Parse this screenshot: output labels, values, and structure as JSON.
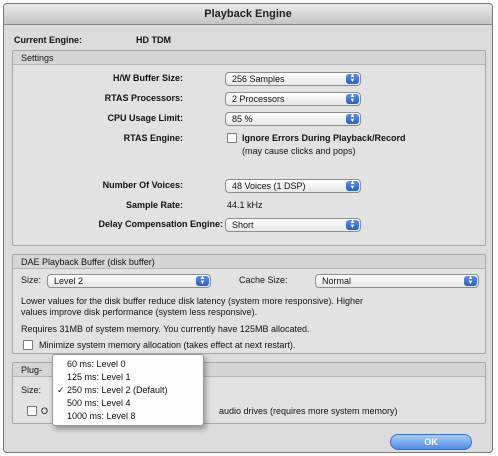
{
  "window": {
    "title": "Playback Engine"
  },
  "engine": {
    "label": "Current Engine:",
    "value": "HD TDM"
  },
  "settings": {
    "title": "Settings",
    "hw_buffer": {
      "label": "H/W Buffer Size:",
      "value": "256 Samples"
    },
    "rtas_processors": {
      "label": "RTAS Processors:",
      "value": "2 Processors"
    },
    "cpu_usage": {
      "label": "CPU Usage Limit:",
      "value": "85 %"
    },
    "rtas_engine": {
      "label": "RTAS Engine:",
      "checkbox_label": "Ignore Errors During Playback/Record",
      "note": "(may cause clicks and pops)"
    },
    "voices": {
      "label": "Number Of Voices:",
      "value": "48 Voices (1 DSP)"
    },
    "sample_rate": {
      "label": "Sample Rate:",
      "value": "44.1 kHz"
    },
    "delay_comp": {
      "label": "Delay Compensation Engine:",
      "value": "Short"
    }
  },
  "dae": {
    "title": "DAE Playback Buffer (disk buffer)",
    "size_label": "Size:",
    "size_value": "Level 2",
    "cache_label": "Cache Size:",
    "cache_value": "Normal",
    "desc_line1": "Lower values for the disk buffer reduce disk latency (system more responsive). Higher",
    "desc_line2": "values improve disk performance (system less responsive).",
    "requirement": "Requires 31MB of system memory. You currently have 125MB allocated.",
    "minimize_label": "Minimize system memory allocation (takes effect at next restart)."
  },
  "plugin": {
    "title": "Plug-",
    "size_label": "Size:",
    "checkbox_prefix": "O",
    "checkbox_tail": "audio drives (requires more system memory)"
  },
  "menu": {
    "items": [
      {
        "label": "60 ms: Level 0",
        "checked": false
      },
      {
        "label": "125 ms: Level 1",
        "checked": false
      },
      {
        "label": "250 ms: Level 2 (Default)",
        "checked": true
      },
      {
        "label": "500 ms: Level 4",
        "checked": false
      },
      {
        "label": "1000 ms: Level 8",
        "checked": false
      }
    ],
    "check_mark": "✓"
  },
  "ok_button": {
    "label": "OK"
  },
  "colors": {
    "accent": "#2a5fc4",
    "ok_button": "#4d8ee6"
  }
}
